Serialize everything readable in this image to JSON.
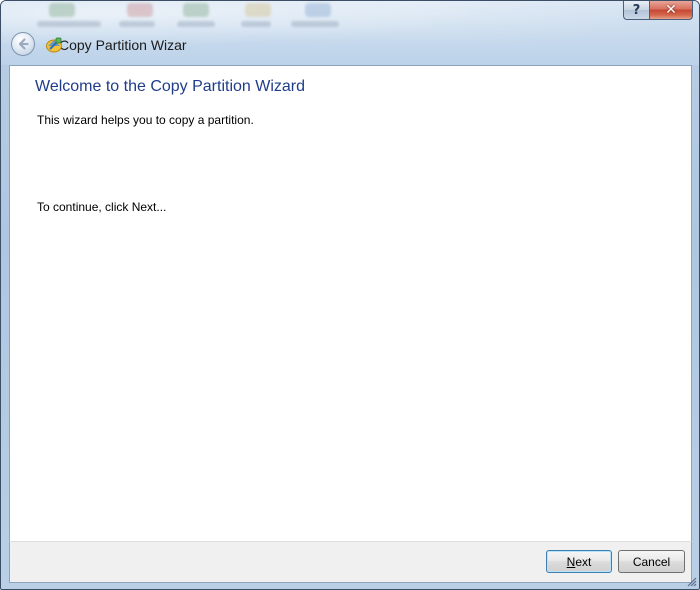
{
  "window": {
    "title": "Copy Partition Wizard",
    "title_visible": "Copy Partition Wizarc",
    "controls": {
      "help_symbol": "?",
      "close_symbol": "✕"
    }
  },
  "navigation": {
    "back_icon": "back-arrow-icon"
  },
  "content": {
    "heading": "Welcome to the Copy Partition Wizard",
    "intro": "This wizard helps you to copy a partition.",
    "continue_hint": "To continue, click Next..."
  },
  "footer": {
    "next_label_first": "N",
    "next_label_rest": "ext",
    "cancel_label": "Cancel"
  },
  "colors": {
    "heading": "#1f3d8a",
    "frame": "#b7cde4",
    "close_button": "#c74633"
  }
}
